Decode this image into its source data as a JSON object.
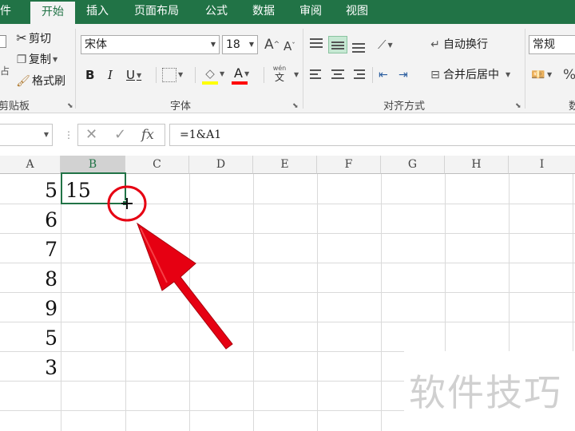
{
  "ribbon": {
    "tabs": [
      {
        "label": "件",
        "active": false
      },
      {
        "label": "开始",
        "active": true
      },
      {
        "label": "插入",
        "active": false
      },
      {
        "label": "页面布局",
        "active": false
      },
      {
        "label": "公式",
        "active": false
      },
      {
        "label": "数据",
        "active": false
      },
      {
        "label": "审阅",
        "active": false
      },
      {
        "label": "视图",
        "active": false
      }
    ],
    "clipboard": {
      "cut": "剪切",
      "copy": "复制",
      "format_painter": "格式刷",
      "group_label": "剪贴板"
    },
    "font": {
      "name": "宋体",
      "size": "18",
      "grow": "A",
      "shrink": "A",
      "bold": "B",
      "italic": "I",
      "underline": "U",
      "font_color_glyph": "A",
      "phonetic_top": "wén",
      "phonetic_bottom": "文",
      "group_label": "字体",
      "fill_color": "#ffff00",
      "font_color": "#ff0000"
    },
    "alignment": {
      "wrap_text": "自动换行",
      "merge_center": "合并后居中",
      "group_label": "对齐方式"
    },
    "number": {
      "format": "常规",
      "percent": "%",
      "group_label": "数"
    }
  },
  "formula_bar": {
    "name_box": "",
    "cancel": "✕",
    "enter": "✓",
    "fx": "fx",
    "formula": "=1&A1"
  },
  "sheet": {
    "columns": [
      "A",
      "B",
      "C",
      "D",
      "E",
      "F",
      "G",
      "H",
      "I"
    ],
    "selected_column": "B",
    "column_a_values": [
      "5",
      "6",
      "7",
      "8",
      "9",
      "5",
      "3"
    ],
    "active_cell_value": "15",
    "active_cell": "B1"
  },
  "watermark": "软件技巧",
  "accent_color": "#217346",
  "annotation_color": "#e60012"
}
